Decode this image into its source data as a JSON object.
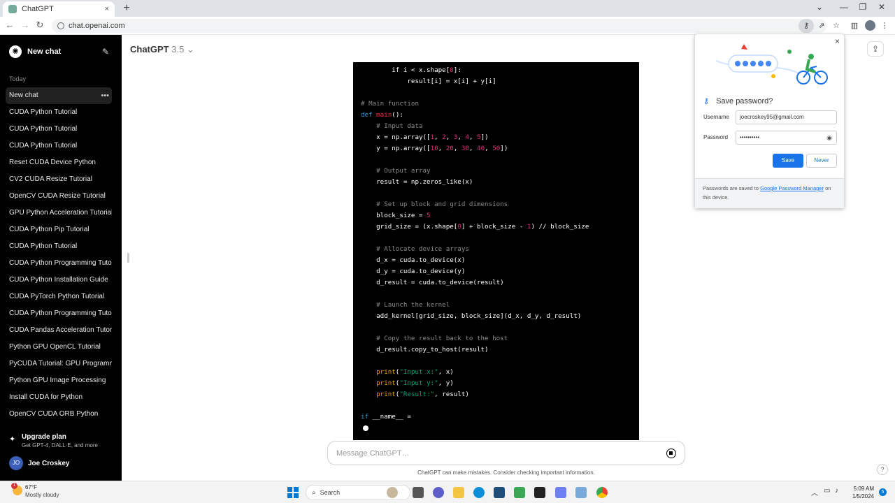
{
  "browser": {
    "tab_title": "ChatGPT",
    "url": "chat.openai.com"
  },
  "sidebar": {
    "new_chat": "New chat",
    "section_today": "Today",
    "chats": [
      "New chat",
      "CUDA Python Tutorial",
      "CUDA Python Tutorial",
      "CUDA Python Tutorial",
      "Reset CUDA Device Python",
      "CV2 CUDA Resize Tutorial",
      "OpenCV CUDA Resize Tutorial",
      "GPU Python Acceleration Tutorial",
      "CUDA Python Pip Tutorial",
      "CUDA Python Tutorial",
      "CUDA Python Programming Tutorial",
      "CUDA Python Installation Guide",
      "CUDA PyTorch Python Tutorial",
      "CUDA Python Programming Tutorial",
      "CUDA Pandas Acceleration Tutorial",
      "Python GPU OpenCL Tutorial",
      "PyCUDA Tutorial: GPU Programming",
      "Python GPU Image Processing",
      "Install CUDA for Python",
      "OpenCV CUDA ORB Python"
    ],
    "upgrade_title": "Upgrade plan",
    "upgrade_sub": "Get GPT-4, DALL·E, and more",
    "user_initials": "JO",
    "user_name": "Joe Croskey"
  },
  "main": {
    "model_name": "ChatGPT",
    "model_version": "3.5",
    "composer_placeholder": "Message ChatGPT…",
    "disclaimer": "ChatGPT can make mistakes. Consider checking important information."
  },
  "code_lines": [
    [
      [
        "t",
        "        if i < x.shape["
      ],
      [
        "nm",
        "0"
      ],
      [
        "t",
        "]:"
      ]
    ],
    [
      [
        "t",
        "            result[i] = x[i] + y[i]"
      ]
    ],
    [],
    [
      [
        "cm",
        "# Main function"
      ]
    ],
    [
      [
        "kw",
        "def "
      ],
      [
        "fn",
        "main"
      ],
      [
        "t",
        "():"
      ]
    ],
    [
      [
        "cm",
        "    # Input data"
      ]
    ],
    [
      [
        "t",
        "    x = np.array(["
      ],
      [
        "nm",
        "1"
      ],
      [
        "t",
        ", "
      ],
      [
        "nm",
        "2"
      ],
      [
        "t",
        ", "
      ],
      [
        "nm",
        "3"
      ],
      [
        "t",
        ", "
      ],
      [
        "nm",
        "4"
      ],
      [
        "t",
        ", "
      ],
      [
        "nm",
        "5"
      ],
      [
        "t",
        "])"
      ]
    ],
    [
      [
        "t",
        "    y = np.array(["
      ],
      [
        "nm",
        "10"
      ],
      [
        "t",
        ", "
      ],
      [
        "nm",
        "20"
      ],
      [
        "t",
        ", "
      ],
      [
        "nm",
        "30"
      ],
      [
        "t",
        ", "
      ],
      [
        "nm",
        "40"
      ],
      [
        "t",
        ", "
      ],
      [
        "nm",
        "50"
      ],
      [
        "t",
        "])"
      ]
    ],
    [],
    [
      [
        "cm",
        "    # Output array"
      ]
    ],
    [
      [
        "t",
        "    result = np.zeros_like(x)"
      ]
    ],
    [],
    [
      [
        "cm",
        "    # Set up block and grid dimensions"
      ]
    ],
    [
      [
        "t",
        "    block_size = "
      ],
      [
        "nm",
        "5"
      ]
    ],
    [
      [
        "t",
        "    grid_size = (x.shape["
      ],
      [
        "nm",
        "0"
      ],
      [
        "t",
        "] + block_size - "
      ],
      [
        "nm",
        "1"
      ],
      [
        "t",
        ") // block_size"
      ]
    ],
    [],
    [
      [
        "cm",
        "    # Allocate device arrays"
      ]
    ],
    [
      [
        "t",
        "    d_x = cuda.to_device(x)"
      ]
    ],
    [
      [
        "t",
        "    d_y = cuda.to_device(y)"
      ]
    ],
    [
      [
        "t",
        "    d_result = cuda.to_device(result)"
      ]
    ],
    [],
    [
      [
        "cm",
        "    # Launch the kernel"
      ]
    ],
    [
      [
        "t",
        "    add_kernel[grid_size, block_size](d_x, d_y, d_result)"
      ]
    ],
    [],
    [
      [
        "cm",
        "    # Copy the result back to the host"
      ]
    ],
    [
      [
        "t",
        "    d_result.copy_to_host(result)"
      ]
    ],
    [],
    [
      [
        "bi",
        "    print"
      ],
      [
        "t",
        "("
      ],
      [
        "st",
        "\"Input x:\""
      ],
      [
        "t",
        ", x)"
      ]
    ],
    [
      [
        "bi",
        "    print"
      ],
      [
        "t",
        "("
      ],
      [
        "st",
        "\"Input y:\""
      ],
      [
        "t",
        ", y)"
      ]
    ],
    [
      [
        "bi",
        "    print"
      ],
      [
        "t",
        "("
      ],
      [
        "st",
        "\"Result:\""
      ],
      [
        "t",
        ", result)"
      ]
    ],
    [],
    [
      [
        "kw",
        "if "
      ],
      [
        "t",
        "__name__ ="
      ]
    ]
  ],
  "password_popup": {
    "title": "Save password?",
    "username_label": "Username",
    "username_value": "joecroskey95@gmail.com",
    "password_label": "Password",
    "password_value": "••••••••••",
    "save_label": "Save",
    "never_label": "Never",
    "footer_prefix": "Passwords are saved to ",
    "footer_link": "Google Password Manager",
    "footer_suffix": " on this device."
  },
  "taskbar": {
    "weather_badge": "1",
    "weather_temp": "67°F",
    "weather_cond": "Mostly cloudy",
    "search_label": "Search",
    "time": "5:09 AM",
    "date": "1/5/2024",
    "notif_count": "5"
  },
  "icons": {
    "tab_close": "×",
    "new_tab": "+",
    "back": "←",
    "forward": "→",
    "reload": "↻",
    "key": "⚷",
    "star": "☆",
    "edit": "✎",
    "more": "•••",
    "spark": "✦",
    "share": "⇪",
    "close": "×",
    "eye": "◉",
    "magnifier": "⌕"
  },
  "colors": {
    "sidebar_bg": "#000000",
    "accent_blue": "#1a73e8",
    "code_keyword": "#2e95d3",
    "code_number": "#df3079",
    "code_string": "#00a67d",
    "code_comment": "#8a8a8a"
  }
}
